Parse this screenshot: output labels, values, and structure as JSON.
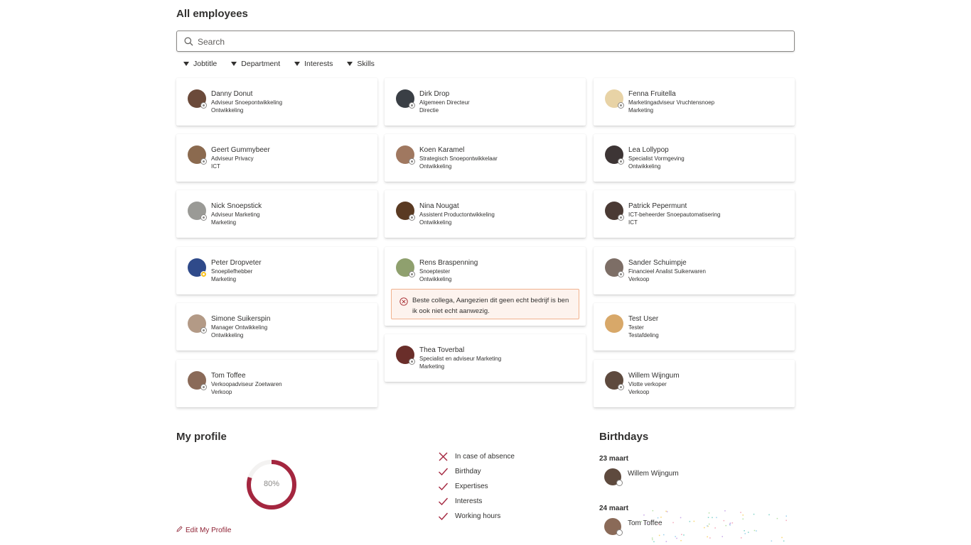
{
  "employees_section": {
    "title": "All employees",
    "search_placeholder": "Search",
    "filters": [
      "Jobtitle",
      "Department",
      "Interests",
      "Skills"
    ]
  },
  "employees": [
    {
      "name": "Danny Donut",
      "job": "Adviseur Snoepontwikkeling",
      "dept": "Ontwikkeling",
      "avatar_color": "#6b4a3a"
    },
    {
      "name": "Dirk Drop",
      "job": "Algemeen Directeur",
      "dept": "Directie",
      "avatar_color": "#3a3f45"
    },
    {
      "name": "Fenna Fruitella",
      "job": "Marketingadviseur Vruchtensnoep",
      "dept": "Marketing",
      "avatar_color": "#e8d3a6"
    },
    {
      "name": "Geert Gummybeer",
      "job": "Adviseur Privacy",
      "dept": "ICT",
      "avatar_color": "#8b6a4f"
    },
    {
      "name": "Koen Karamel",
      "job": "Strategisch Snoepontwikkelaar",
      "dept": "Ontwikkeling",
      "avatar_color": "#a07860"
    },
    {
      "name": "Lea Lollypop",
      "job": "Specialist Vormgeving",
      "dept": "Ontwikkeling",
      "avatar_color": "#3d3535"
    },
    {
      "name": "Nick Snoepstick",
      "job": "Adviseur Marketing",
      "dept": "Marketing",
      "avatar_color": "#9a9a96"
    },
    {
      "name": "Nina Nougat",
      "job": "Assistent Productontwikkeling",
      "dept": "Ontwikkeling",
      "avatar_color": "#5a3a22"
    },
    {
      "name": "Patrick Pepermunt",
      "job": "ICT-beheerder Snoepautomatisering",
      "dept": "ICT",
      "avatar_color": "#4a3a34"
    },
    {
      "name": "Peter Dropveter",
      "job": "Snoepliefhebber",
      "dept": "Marketing",
      "avatar_color": "#2f4a8a"
    },
    {
      "name": "Rens Braspenning",
      "job": "Snoeptester",
      "dept": "Ontwikkeling",
      "avatar_color": "#8fa06e"
    },
    {
      "name": "Sander Schuimpje",
      "job": "Financieel Analist Suikerwaren",
      "dept": "Verkoop",
      "avatar_color": "#7d6e66"
    },
    {
      "name": "Simone Suikerspin",
      "job": "Manager Ontwikkeling",
      "dept": "Ontwikkeling",
      "avatar_color": "#b39a86"
    },
    {
      "name": "Thea Toverbal",
      "job": "Specialist en adviseur Marketing",
      "dept": "Marketing",
      "avatar_color": "#6a2e2a"
    },
    {
      "name": "Test User",
      "job": "Tester",
      "dept": "Testafdeling",
      "avatar_color": "#d8a869"
    },
    {
      "name": "Tom Toffee",
      "job": "Verkoopadviseur Zoetwaren",
      "dept": "Verkoop",
      "avatar_color": "#8a6a58"
    },
    {
      "name": "Willem Wijngum",
      "job": "Vlotte verkoper",
      "dept": "Verkoop",
      "avatar_color": "#5e4a3e"
    }
  ],
  "alert": {
    "message": "Beste collega, Aangezien dit geen echt bedrijf is ben ik ook niet echt aanwezig."
  },
  "profile": {
    "title": "My profile",
    "completion_percent": 80,
    "completion_label": "80%",
    "edit_label": "Edit My Profile",
    "checklist": [
      {
        "label": "In case of absence",
        "done": false
      },
      {
        "label": "Birthday",
        "done": true
      },
      {
        "label": "Expertises",
        "done": true
      },
      {
        "label": "Interests",
        "done": true
      },
      {
        "label": "Working hours",
        "done": true
      }
    ],
    "accent_color": "#a4263f"
  },
  "birthdays": {
    "title": "Birthdays",
    "entries": [
      {
        "date": "23 maart",
        "name": "Willem Wijngum"
      },
      {
        "date": "24 maart",
        "name": "Tom Toffee"
      }
    ]
  }
}
